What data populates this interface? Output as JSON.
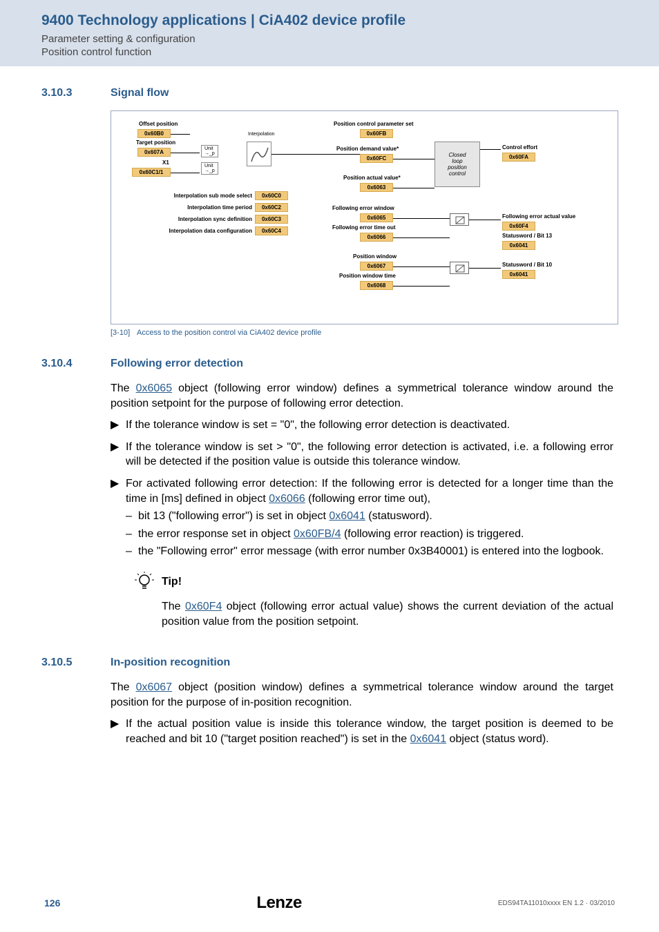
{
  "header": {
    "title": "9400 Technology applications | CiA402 device profile",
    "line1": "Parameter setting & configuration",
    "line2": "Position control function"
  },
  "section_310_3": {
    "num": "3.10.3",
    "title": "Signal flow"
  },
  "diagram": {
    "offset_position": "Offset position",
    "b0": "0x60B0",
    "target_position": "Target position",
    "a607": "0x607A",
    "x1": "X1",
    "c1_1": "0x60C1/1",
    "unit_p1": "Unit → _p",
    "unit_p2": "Unit → _p",
    "interpolation": "Interpolation",
    "isms": "Interpolation sub mode select",
    "c0": "0x60C0",
    "itp": "Interpolation time period",
    "c2": "0x60C2",
    "isd": "Interpolation sync definition",
    "c3": "0x60C3",
    "idc": "Interpolation data configuration",
    "c4": "0x60C4",
    "pcps": "Position control parameter set",
    "fb": "0x60FB",
    "pdv": "Position demand value*",
    "fc": "0x60FC",
    "pav": "Position actual value*",
    "p6063": "0x6063",
    "few": "Following error window",
    "p6065": "0x6065",
    "feto": "Following error time out",
    "p6066": "0x6066",
    "pw": "Position window",
    "p6067": "0x6067",
    "pwt": "Position window time",
    "p6068": "0x6068",
    "clpc": "Closed loop position control",
    "ce": "Control effort",
    "fa": "0x60FA",
    "feav": "Following error actual value",
    "f4": "0x60F4",
    "sw13": "Statusword / Bit 13",
    "p6041a": "0x6041",
    "sw10": "Statusword / Bit 10",
    "p6041b": "0x6041"
  },
  "caption": {
    "num": "[3-10]",
    "text": "Access to the position control via CiA402 device profile"
  },
  "section_310_4": {
    "num": "3.10.4",
    "title": "Following error detection",
    "p1a": "The ",
    "p1_link": "0x6065",
    "p1b": " object (following error window) defines a symmetrical tolerance window around the position setpoint for the purpose of following error detection.",
    "b1": "If the tolerance window is set  = \"0\", the following error detection is deactivated.",
    "b2": "If the tolerance window is set > \"0\", the following error detection is activated, i.e. a following error will be detected if the position value is outside this tolerance window.",
    "b3a": "For activated following error detection: If the following error is detected for a longer time than the time in [ms] defined in object ",
    "b3_link": "0x6066",
    "b3c": " (following error time out),",
    "d1a": "bit 13 (\"following error\") is set in object ",
    "d1_link": "0x6041",
    "d1b": " (statusword).",
    "d2a": "the error response set in object ",
    "d2_link": "0x60FB/4",
    "d2b": " (following error reaction) is triggered.",
    "d3": "the \"Following error\" error message (with error number 0x3B40001) is entered into the logbook.",
    "tip_label": "Tip!",
    "tip_a": "The ",
    "tip_link": "0x60F4",
    "tip_b": " object (following error actual value) shows the current deviation of the actual position value from the position setpoint."
  },
  "section_310_5": {
    "num": "3.10.5",
    "title": "In-position recognition",
    "p1a": "The ",
    "p1_link": "0x6067",
    "p1b": " object (position window) defines a symmetrical tolerance window around the target position for the purpose of in-position recognition.",
    "b1a": "If the actual position value is inside this tolerance window, the target position is deemed to be reached and bit 10 (\"target position reached\") is set in the ",
    "b1_link": "0x6041",
    "b1b": " object (status word)."
  },
  "footer": {
    "page": "126",
    "logo": "Lenze",
    "code": "EDS94TA11010xxxx EN 1.2 · 03/2010"
  }
}
